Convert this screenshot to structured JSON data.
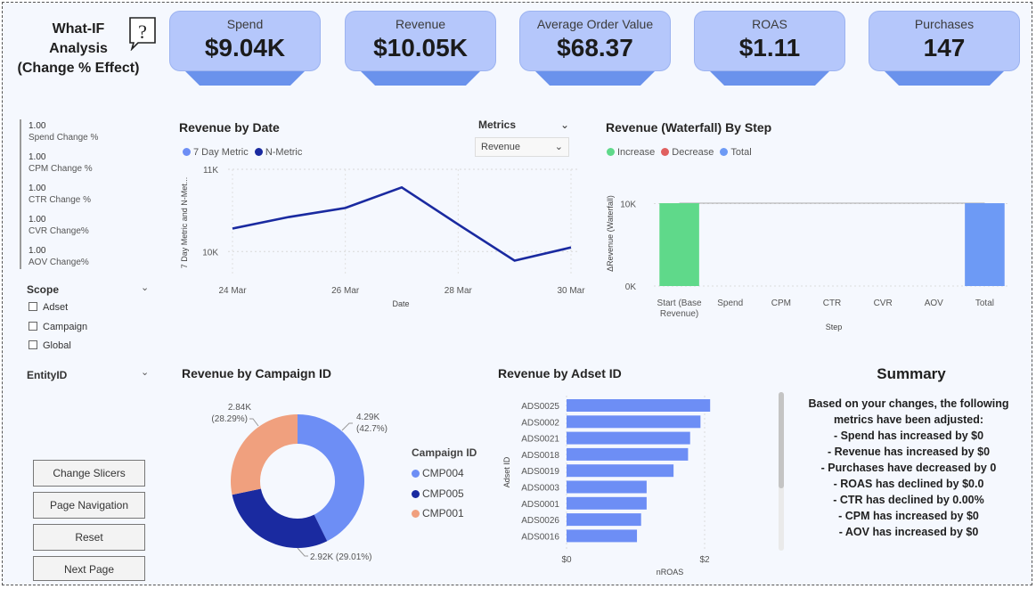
{
  "header": {
    "title_lines": [
      "What-IF",
      "Analysis",
      "(Change % Effect)"
    ]
  },
  "kpis": [
    {
      "label": "Spend",
      "value": "$9.04K"
    },
    {
      "label": "Revenue",
      "value": "$10.05K"
    },
    {
      "label": "Average Order Value",
      "value": "$68.37"
    },
    {
      "label": "ROAS",
      "value": "$1.11"
    },
    {
      "label": "Purchases",
      "value": "147"
    }
  ],
  "sliders": [
    {
      "value": "1.00",
      "label": "Spend Change %"
    },
    {
      "value": "1.00",
      "label": "CPM Change %"
    },
    {
      "value": "1.00",
      "label": "CTR Change %"
    },
    {
      "value": "1.00",
      "label": "CVR Change%"
    },
    {
      "value": "1.00",
      "label": "AOV Change%"
    }
  ],
  "scope": {
    "label": "Scope",
    "options": [
      "Adset",
      "Campaign",
      "Global"
    ]
  },
  "entity": {
    "label": "EntityID"
  },
  "buttons": [
    "Change Slicers",
    "Page Navigation",
    "Reset",
    "Next Page"
  ],
  "metrics_slicer": {
    "label": "Metrics",
    "selected": "Revenue"
  },
  "colors": {
    "kpi_card": "#b5c7fb",
    "kpi_base": "#6a92ec",
    "line": "#1a2aa0",
    "increase": "#5fd98a",
    "decrease": "#e06060",
    "total": "#6d9af5",
    "bar": "#6d8ef5",
    "donut_cmp004": "#6d8ef5",
    "donut_cmp005": "#1a2aa0",
    "donut_cmp001": "#f0a07e"
  },
  "chart_data": [
    {
      "type": "line",
      "title": "Revenue by Date",
      "legend": [
        "7 Day Metric",
        "N-Metric"
      ],
      "xlabel": "Date",
      "ylabel": "7 Day Metric and N-Met...",
      "x": [
        "24 Mar",
        "25 Mar",
        "26 Mar",
        "27 Mar",
        "28 Mar",
        "29 Mar",
        "30 Mar"
      ],
      "x_ticks": [
        "24 Mar",
        "26 Mar",
        "28 Mar",
        "30 Mar"
      ],
      "y_ticks": [
        "10K",
        "11K"
      ],
      "series": [
        {
          "name": "N-Metric",
          "values": [
            10280,
            10420,
            10530,
            10780,
            10330,
            9890,
            10050
          ]
        }
      ],
      "ylim": [
        9700,
        11000
      ]
    },
    {
      "type": "bar",
      "title": "Revenue (Waterfall) By Step",
      "legend": [
        "Increase",
        "Decrease",
        "Total"
      ],
      "xlabel": "Step",
      "ylabel": "ΔRevenue (Waterfall)",
      "categories": [
        "Start (Base Revenue)",
        "Spend",
        "CPM",
        "CTR",
        "CVR",
        "AOV",
        "Total"
      ],
      "values": [
        10050,
        0,
        0,
        0,
        0,
        0,
        10050
      ],
      "y_ticks": [
        "0K",
        "10K"
      ],
      "ylim": [
        0,
        12000
      ]
    },
    {
      "type": "pie",
      "title": "Revenue by Campaign ID",
      "legend_title": "Campaign ID",
      "categories": [
        "CMP004",
        "CMP005",
        "CMP001"
      ],
      "values": [
        4290,
        2920,
        2840
      ],
      "labels": [
        "4.29K (42.7%)",
        "2.92K (29.01%)",
        "2.84K (28.29%)"
      ]
    },
    {
      "type": "bar",
      "title": "Revenue by Adset ID",
      "xlabel": "nROAS",
      "ylabel": "Adset ID",
      "categories": [
        "ADS0025",
        "ADS0002",
        "ADS0021",
        "ADS0018",
        "ADS0019",
        "ADS0003",
        "ADS0001",
        "ADS0026",
        "ADS0016"
      ],
      "values": [
        2.08,
        1.94,
        1.79,
        1.76,
        1.55,
        1.16,
        1.16,
        1.08,
        1.02
      ],
      "x_ticks": [
        "$0",
        "$2"
      ],
      "xlim": [
        0,
        2
      ]
    }
  ],
  "summary": {
    "title": "Summary",
    "lines": [
      "Based on your changes, the following",
      "metrics have been adjusted:",
      "- Spend has increased by $0",
      "- Revenue has increased by $0",
      "- Purchases have decreased by 0",
      "- ROAS has declined by $0.0",
      "- CTR has declined by 0.00%",
      "- CPM has increased by $0",
      "- AOV has increased by $0"
    ]
  }
}
